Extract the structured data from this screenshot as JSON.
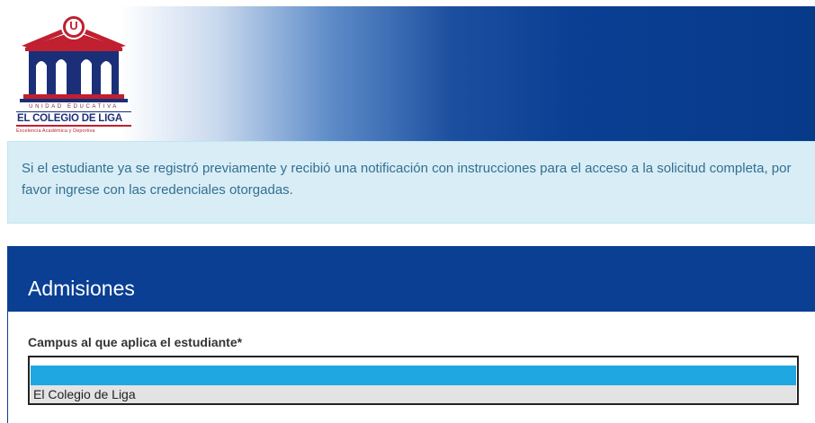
{
  "logo": {
    "badge_letter": "U",
    "line1": "UNIDAD EDUCATIVA",
    "line2": "EL COLEGIO DE LIGA",
    "line3": "Excelencia Académica y Deportiva",
    "colors": {
      "red": "#c0202f",
      "navy": "#1b2f78"
    }
  },
  "notice": {
    "text": "Si el estudiante ya se registró previamente y recibió una notificación con instrucciones para el acceso a la solicitud completa, por favor ingrese con las credenciales otorgadas."
  },
  "admissions": {
    "title": "Admisiones",
    "campus_label": "Campus al que aplica el estudiante*",
    "campus_options": [
      "",
      "El Colegio de Liga"
    ],
    "highlighted_option": ""
  },
  "colors": {
    "header_blue": "#0a3f93",
    "notice_bg": "#d9edf7",
    "notice_text": "#31708f",
    "option_highlight": "#1fa7e2"
  }
}
